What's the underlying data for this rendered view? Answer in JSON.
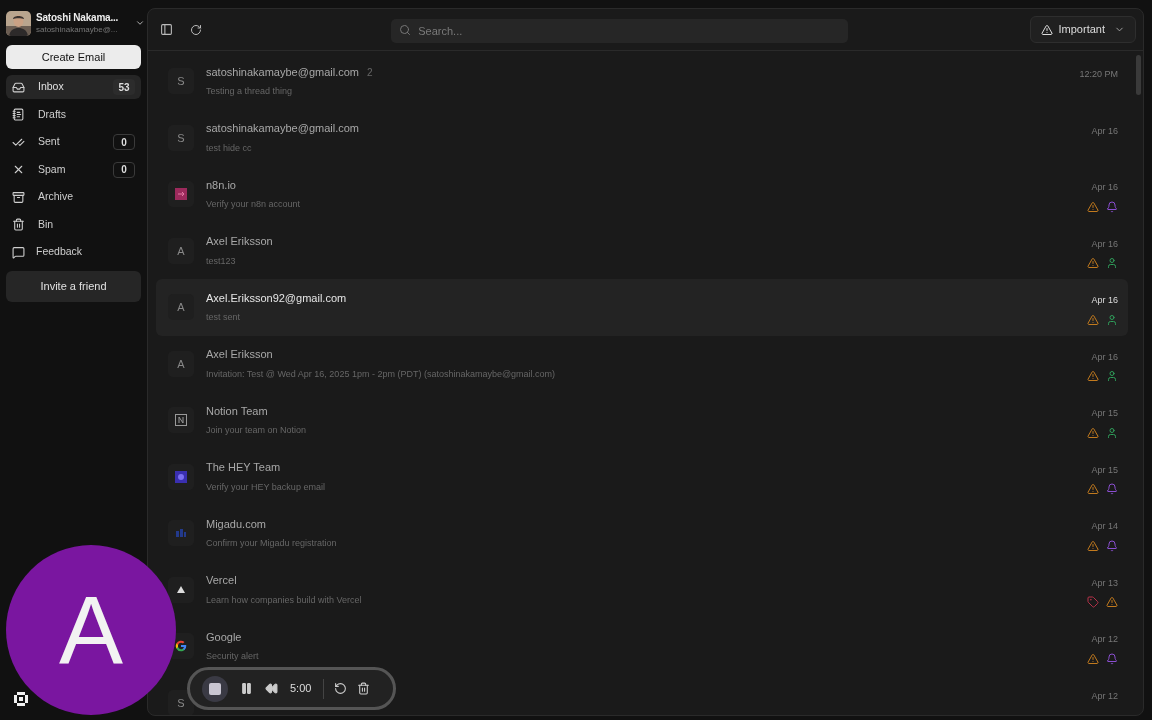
{
  "account": {
    "name": "Satoshi Nakama...",
    "email": "satoshinakamaybe@..."
  },
  "create_button": "Create Email",
  "nav": [
    {
      "kind": "inbox",
      "label": "Inbox",
      "count": "53",
      "selected": true
    },
    {
      "kind": "drafts",
      "label": "Drafts",
      "selected": false
    },
    {
      "kind": "sent",
      "label": "Sent",
      "count": "0",
      "selected": false
    },
    {
      "kind": "spam",
      "label": "Spam",
      "count": "0",
      "selected": false
    },
    {
      "kind": "archive",
      "label": "Archive",
      "selected": false
    },
    {
      "kind": "bin",
      "label": "Bin",
      "selected": false
    },
    {
      "kind": "feedback",
      "label": "Feedback",
      "selected": false
    }
  ],
  "invite_button": "Invite a friend",
  "search": {
    "placeholder": "Search..."
  },
  "filter": {
    "label": "Important"
  },
  "emails": [
    {
      "avatar": {
        "kind": "letter",
        "text": "S"
      },
      "sender": "satoshinakamaybe@gmail.com",
      "thread_count": "2",
      "subject": "Testing a thread thing",
      "date": "12:20 PM",
      "selected": false
    },
    {
      "avatar": {
        "kind": "letter",
        "text": "S"
      },
      "sender": "satoshinakamaybe@gmail.com",
      "subject": "test hide cc",
      "date": "Apr 16",
      "selected": false
    },
    {
      "avatar": {
        "kind": "n8n"
      },
      "sender": "n8n.io",
      "subject": "Verify your n8n account",
      "date": "Apr 16",
      "selected": false,
      "tags": [
        {
          "kind": "warning"
        },
        {
          "kind": "bell"
        }
      ]
    },
    {
      "avatar": {
        "kind": "letter",
        "text": "A"
      },
      "sender": "Axel Eriksson",
      "subject": "test123",
      "date": "Apr 16",
      "selected": false,
      "tags": [
        {
          "kind": "warning"
        },
        {
          "kind": "person"
        }
      ]
    },
    {
      "avatar": {
        "kind": "letter",
        "text": "A"
      },
      "sender": "Axel.Eriksson92@gmail.com",
      "subject": "test sent",
      "date": "Apr 16",
      "selected": true,
      "tags": [
        {
          "kind": "warning"
        },
        {
          "kind": "person"
        }
      ]
    },
    {
      "avatar": {
        "kind": "letter",
        "text": "A"
      },
      "sender": "Axel Eriksson",
      "subject": "Invitation: Test @ Wed Apr 16, 2025 1pm - 2pm (PDT) (satoshinakamaybe@gmail.com)",
      "date": "Apr 16",
      "selected": false,
      "tags": [
        {
          "kind": "warning"
        },
        {
          "kind": "person"
        }
      ]
    },
    {
      "avatar": {
        "kind": "notion"
      },
      "sender": "Notion Team",
      "subject": "Join your team on Notion",
      "date": "Apr 15",
      "selected": false,
      "tags": [
        {
          "kind": "warning"
        },
        {
          "kind": "person"
        }
      ]
    },
    {
      "avatar": {
        "kind": "hey"
      },
      "sender": "The HEY Team",
      "subject": "Verify your HEY backup email",
      "date": "Apr 15",
      "selected": false,
      "tags": [
        {
          "kind": "warning"
        },
        {
          "kind": "bell"
        }
      ]
    },
    {
      "avatar": {
        "kind": "migadu"
      },
      "sender": "Migadu.com",
      "subject": "Confirm your Migadu registration",
      "date": "Apr 14",
      "selected": false,
      "tags": [
        {
          "kind": "warning"
        },
        {
          "kind": "bell"
        }
      ]
    },
    {
      "avatar": {
        "kind": "vercel"
      },
      "sender": "Vercel",
      "subject": "Learn how companies build with Vercel",
      "date": "Apr 13",
      "selected": false,
      "tags": [
        {
          "kind": "tag"
        },
        {
          "kind": "warning"
        }
      ]
    },
    {
      "avatar": {
        "kind": "google"
      },
      "sender": "Google",
      "subject": "Security alert",
      "date": "Apr 12",
      "selected": false,
      "tags": [
        {
          "kind": "warning"
        },
        {
          "kind": "bell"
        }
      ]
    },
    {
      "avatar": {
        "kind": "letter",
        "text": "S"
      },
      "date": "Apr 12",
      "selected": false
    }
  ],
  "recorder": {
    "time": "5:00"
  },
  "camera_overlay": {
    "initial": "A"
  }
}
